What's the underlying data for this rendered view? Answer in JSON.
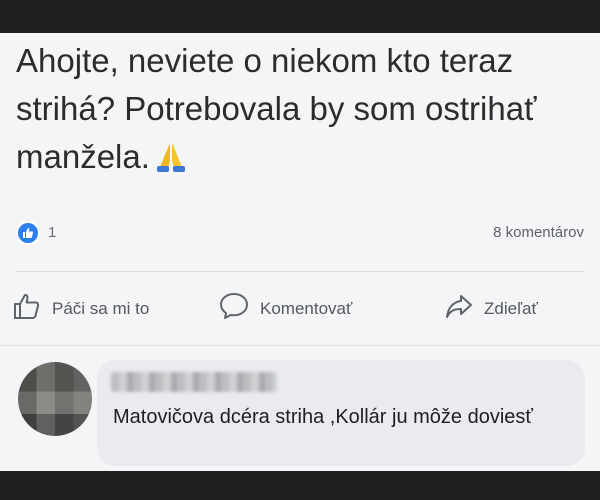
{
  "post": {
    "text": "Ahojte, neviete o niekom kto teraz strihá? Potrebovala by som ostrihať manžela.",
    "emoji": "folded-hands"
  },
  "stats": {
    "likes": "1",
    "comments": "8 komentárov"
  },
  "actions": {
    "like_label": "Páči sa mi to",
    "comment_label": "Komentovať",
    "share_label": "Zdieľať"
  },
  "comment": {
    "text": "Matovičova dcéra  striha ,Kollár ju môže doviesť"
  },
  "colors": {
    "like_badge": "#2d7ff0",
    "card_background": "#f4f5f7",
    "comment_bubble": "#e9ebee"
  }
}
